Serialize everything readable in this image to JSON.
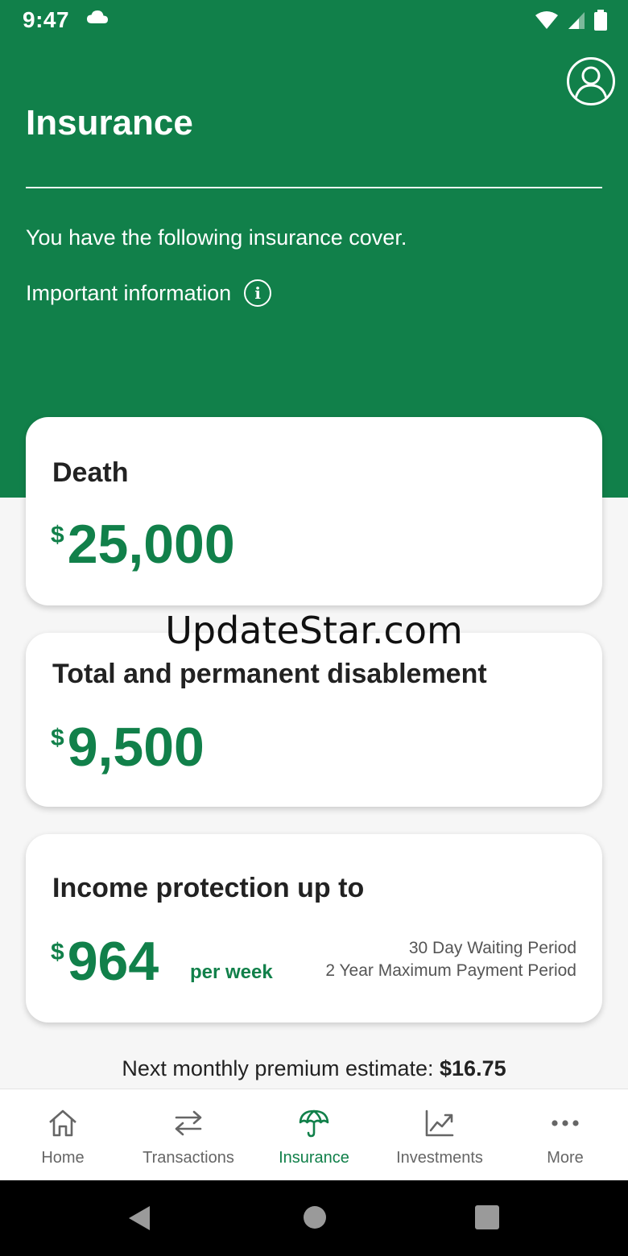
{
  "status_bar": {
    "time": "9:47"
  },
  "header": {
    "title": "Insurance",
    "subtitle": "You have the following insurance cover.",
    "important_info": "Important information"
  },
  "cards": {
    "death": {
      "title": "Death",
      "currency": "$",
      "amount": "25,000"
    },
    "tpd": {
      "title": "Total and permanent disablement",
      "currency": "$",
      "amount": "9,500"
    },
    "income_protection": {
      "title": "Income protection up to",
      "currency": "$",
      "amount": "964",
      "unit": "per week",
      "waiting_period": "30 Day Waiting Period",
      "max_payment_period": "2 Year Maximum Payment Period"
    }
  },
  "watermark": "UpdateStar.com",
  "premium": {
    "label": "Next monthly premium estimate:",
    "value": "$16.75"
  },
  "bottom_nav": {
    "items": [
      {
        "label": "Home",
        "icon": "home-icon"
      },
      {
        "label": "Transactions",
        "icon": "transfer-arrows-icon"
      },
      {
        "label": "Insurance",
        "icon": "umbrella-icon",
        "active": true
      },
      {
        "label": "Investments",
        "icon": "line-chart-icon"
      },
      {
        "label": "More",
        "icon": "more-dots-icon"
      }
    ]
  },
  "colors": {
    "brand_green": "#11804a",
    "background": "#f6f6f6",
    "nav_inactive": "#666666"
  }
}
